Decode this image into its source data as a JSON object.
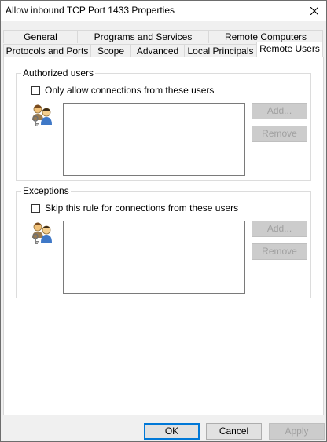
{
  "window": {
    "title": "Allow inbound TCP Port 1433 Properties"
  },
  "tabs": {
    "row_back": [
      "General",
      "Programs and Services",
      "Remote Computers"
    ],
    "row_front": [
      "Protocols and Ports",
      "Scope",
      "Advanced",
      "Local Principals",
      "Remote Users"
    ],
    "active": "Remote Users"
  },
  "authorized": {
    "group_title": "Authorized users",
    "checkbox_label": "Only allow connections from these users",
    "checked": false,
    "add_label": "Add...",
    "remove_label": "Remove",
    "icon": "users-keys-icon"
  },
  "exceptions": {
    "group_title": "Exceptions",
    "checkbox_label": "Skip this rule for connections from these users",
    "checked": false,
    "add_label": "Add...",
    "remove_label": "Remove",
    "icon": "users-keys-icon"
  },
  "footer": {
    "ok_label": "OK",
    "cancel_label": "Cancel",
    "apply_label": "Apply"
  },
  "colors": {
    "accent": "#0078d7",
    "window_bg": "#f0f0f0"
  }
}
